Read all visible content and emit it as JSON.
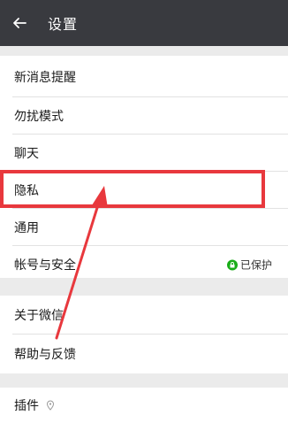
{
  "header": {
    "title": "设置"
  },
  "settings": {
    "items": [
      {
        "label": "新消息提醒"
      },
      {
        "label": "勿扰模式"
      },
      {
        "label": "聊天"
      },
      {
        "label": "隐私"
      },
      {
        "label": "通用"
      },
      {
        "label": "帐号与安全",
        "status": "已保护"
      }
    ]
  },
  "about": {
    "items": [
      {
        "label": "关于微信"
      },
      {
        "label": "帮助与反馈"
      }
    ]
  },
  "plugins": {
    "label": "插件"
  },
  "colors": {
    "topbar": "#393a3f",
    "highlight": "#e8383d",
    "protected_badge": "#1aad19"
  },
  "icons": [
    "back-arrow-icon",
    "lock-icon",
    "location-pin-icon"
  ]
}
